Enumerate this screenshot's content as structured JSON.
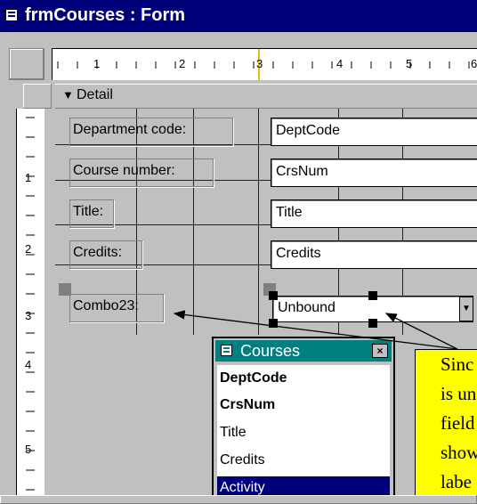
{
  "window": {
    "title": "frmCourses : Form"
  },
  "ruler": {
    "h_numbers": [
      "1",
      "2",
      "3",
      "4",
      "5",
      "6"
    ],
    "v_numbers": [
      "1",
      "2",
      "3",
      "4",
      "5"
    ]
  },
  "section": {
    "label": "Detail"
  },
  "controls": [
    {
      "label": "Department code:",
      "field": "DeptCode"
    },
    {
      "label": "Course number:",
      "field": "CrsNum"
    },
    {
      "label": "Title:",
      "field": "Title"
    },
    {
      "label": "Credits:",
      "field": "Credits"
    }
  ],
  "combo": {
    "label": "Combo23:",
    "value": "Unbound"
  },
  "field_list": {
    "title": "Courses",
    "close": "×",
    "items": [
      {
        "name": "DeptCode",
        "bold": true
      },
      {
        "name": "CrsNum",
        "bold": true
      },
      {
        "name": "Title",
        "bold": false
      },
      {
        "name": "Credits",
        "bold": false
      },
      {
        "name": "Activity",
        "bold": false,
        "selected": true
      }
    ]
  },
  "callout": {
    "lines": [
      "Sinc",
      "is un",
      "field",
      "show",
      "labe"
    ]
  },
  "colors": {
    "titlebar": "#00007b",
    "form_bg": "#c0c0c0",
    "field_list_title": "#008080",
    "callout_bg": "#ffff00",
    "selection": "#00007b",
    "ruler_marker": "#e0c000"
  }
}
